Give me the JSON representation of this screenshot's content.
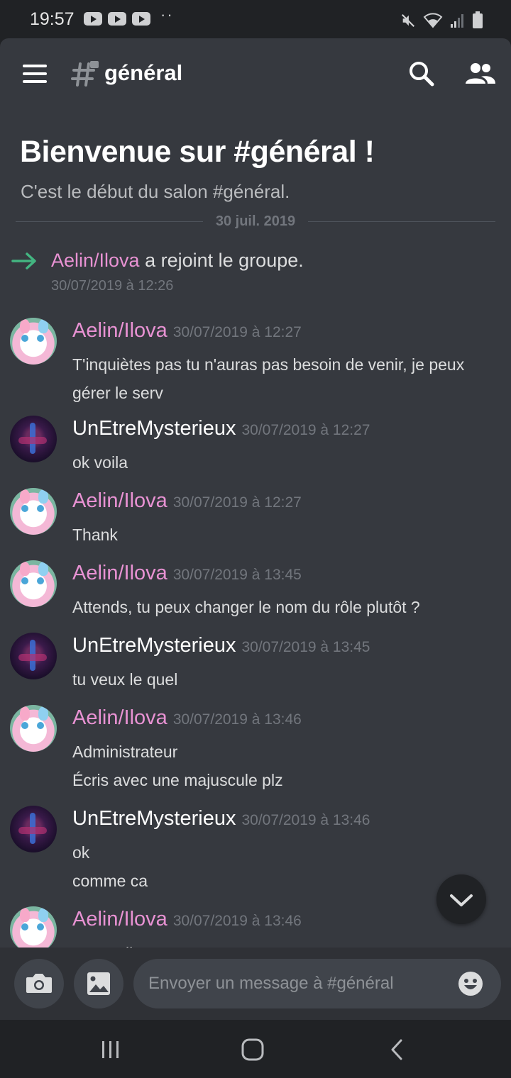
{
  "status_bar": {
    "time": "19:57",
    "notification_icons": [
      "youtube-icon",
      "youtube-icon",
      "youtube-icon"
    ],
    "more_dots": "··"
  },
  "header": {
    "channel_name": "général",
    "icons": [
      "menu-icon",
      "locked-hash-icon",
      "search-icon",
      "members-icon"
    ]
  },
  "welcome": {
    "title": "Bienvenue sur #général !",
    "subtitle": "C'est le début du salon #général.",
    "date_divider": "30 juil. 2019"
  },
  "join_event": {
    "username": "Aelin/Ilova",
    "text": "a rejoint le groupe.",
    "timestamp": "30/07/2019 à 12:26"
  },
  "messages": [
    {
      "author": "Aelin/Ilova",
      "avatar": "sylveon-avatar",
      "timestamp": "30/07/2019 à 12:27",
      "lines": [
        "T'inquiètes pas tu n'auras pas besoin de venir, je peux gérer le serv"
      ]
    },
    {
      "author": "UnEtreMysterieux",
      "avatar": "mystery-avatar",
      "timestamp": "30/07/2019 à 12:27",
      "lines": [
        "ok voila"
      ]
    },
    {
      "author": "Aelin/Ilova",
      "avatar": "sylveon-avatar",
      "timestamp": "30/07/2019 à 12:27",
      "lines": [
        "Thank"
      ]
    },
    {
      "author": "Aelin/Ilova",
      "avatar": "sylveon-avatar",
      "timestamp": "30/07/2019 à 13:45",
      "lines": [
        "Attends, tu peux changer le nom du rôle plutôt ?"
      ]
    },
    {
      "author": "UnEtreMysterieux",
      "avatar": "mystery-avatar",
      "timestamp": "30/07/2019 à 13:45",
      "lines": [
        "tu veux le quel"
      ]
    },
    {
      "author": "Aelin/Ilova",
      "avatar": "sylveon-avatar",
      "timestamp": "30/07/2019 à 13:46",
      "lines": [
        "Administrateur",
        "Écris avec une majuscule plz"
      ]
    },
    {
      "author": "UnEtreMysterieux",
      "avatar": "mystery-avatar",
      "timestamp": "30/07/2019 à 13:46",
      "lines": [
        "ok",
        "comme ca"
      ]
    },
    {
      "author": "Aelin/Ilova",
      "avatar": "sylveon-avatar",
      "timestamp": "30/07/2019 à 13:46",
      "lines": [
        "Ayyyouii"
      ]
    }
  ],
  "composer": {
    "placeholder": "Envoyer un message à #général",
    "icons": [
      "camera-icon",
      "image-icon",
      "emoji-icon"
    ]
  },
  "nav_bar": {
    "icons": [
      "recent-apps-icon",
      "home-icon",
      "back-icon"
    ]
  },
  "colors": {
    "background": "#36393f",
    "header": "#36393f",
    "composer": "#2f3136",
    "system_bar": "#202225",
    "username_pink": "#e892d3",
    "join_arrow": "#43b581",
    "timestamp": "#72767d",
    "text": "#dcddde"
  }
}
